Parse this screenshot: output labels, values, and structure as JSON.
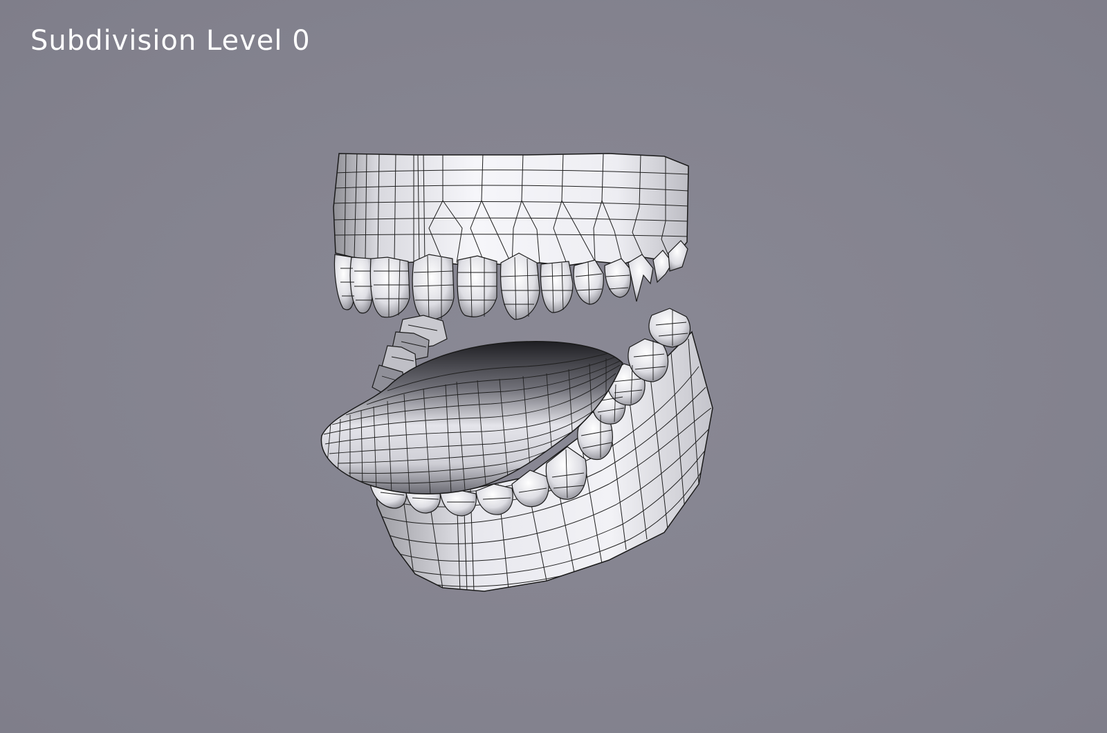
{
  "caption": "Subdivision Level 0",
  "colors": {
    "background": "#858490",
    "caption_text": "#ffffff",
    "mesh_light": "#f4f4f8",
    "mesh_shadow": "#3a3a3e",
    "wire": "#1a1a1a"
  }
}
